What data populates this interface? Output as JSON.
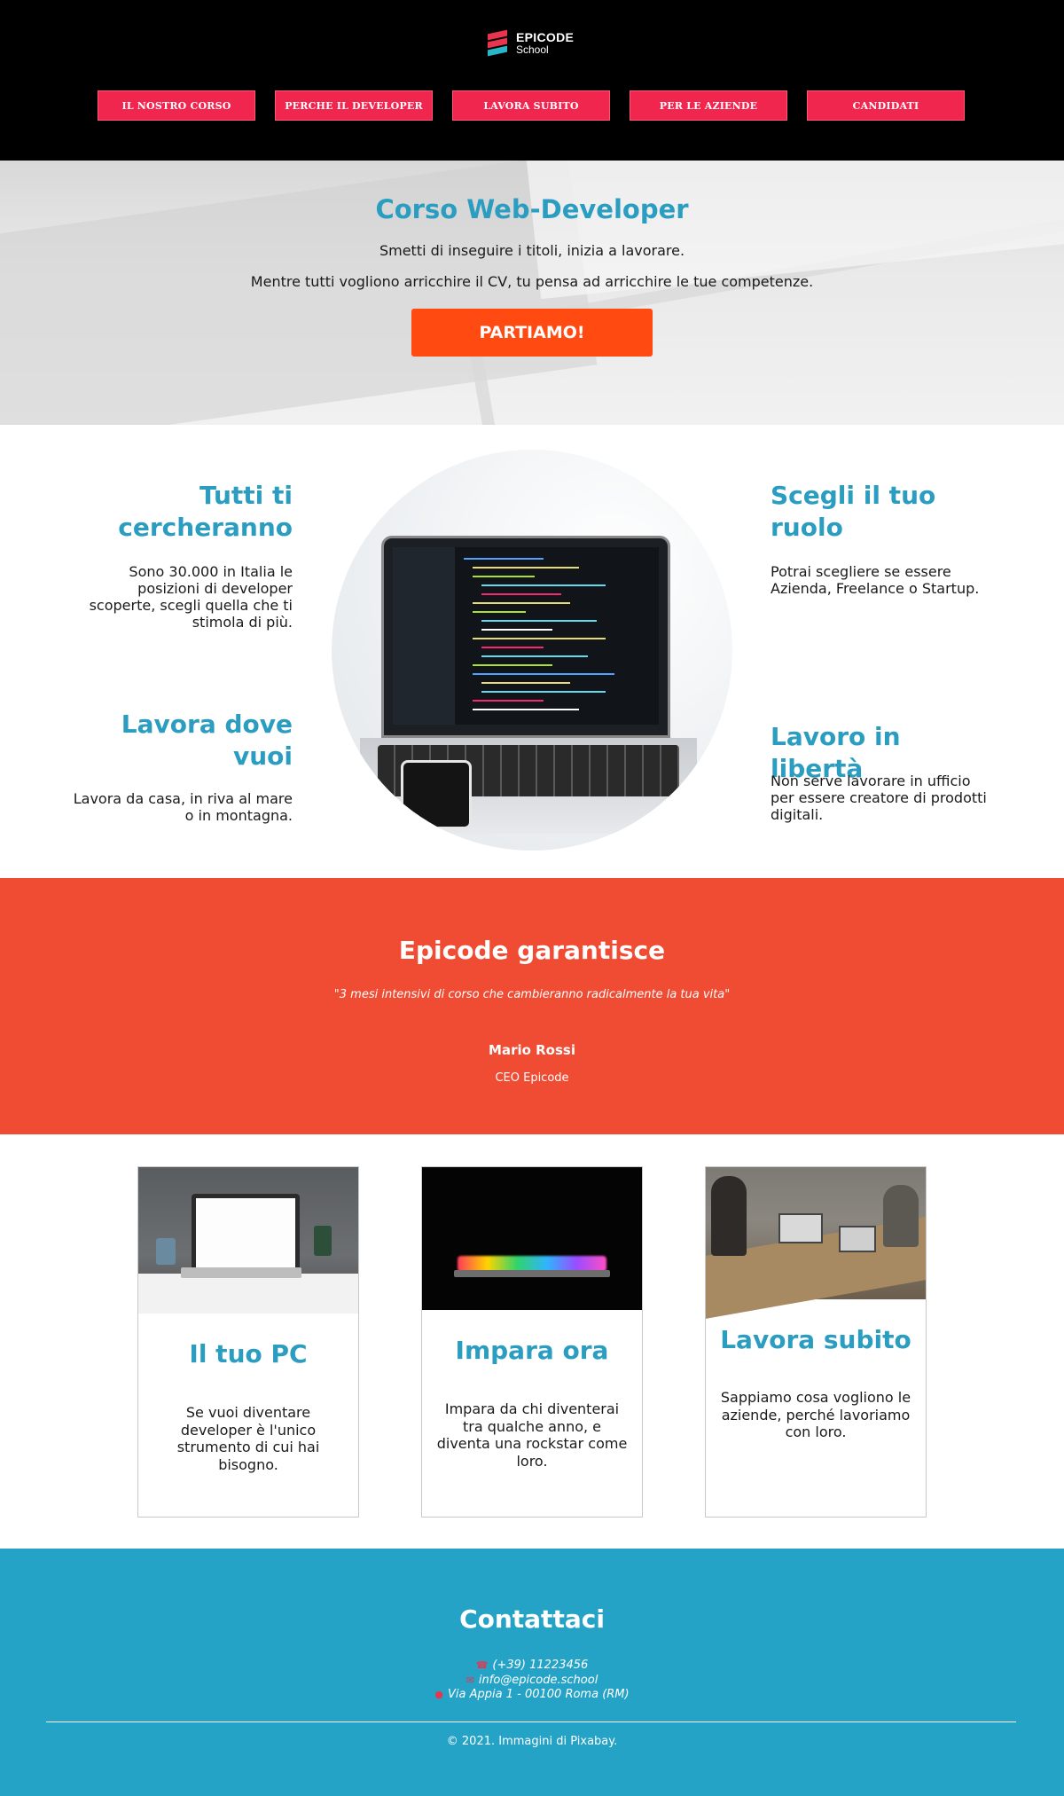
{
  "header": {
    "logo": {
      "title": "EPICODE",
      "subtitle": "School"
    },
    "nav": [
      {
        "label": "IL NOSTRO CORSO"
      },
      {
        "label": "PERCHE IL DEVELOPER"
      },
      {
        "label": "LAVORA SUBITO"
      },
      {
        "label": "PER LE AZIENDE"
      },
      {
        "label": "CANDIDATI"
      }
    ]
  },
  "hero": {
    "title": "Corso Web-Developer",
    "line1": "Smetti di inseguire i titoli, inizia a lavorare.",
    "line2": "Mentre tutti vogliono arricchire il CV, tu pensa ad arricchire le tue competenze.",
    "cta": "PARTIAMO!"
  },
  "features": [
    {
      "title": "Tutti ti cercheranno",
      "text": "Sono 30.000 in Italia le posizioni di developer scoperte, scegli quella che ti stimola di più."
    },
    {
      "title": "Scegli il tuo ruolo",
      "text": "Potrai scegliere se essere Azienda, Freelance o Startup."
    },
    {
      "title": "Lavora dove vuoi",
      "text": "Lavora da casa, in riva al mare o in montagna."
    },
    {
      "title": "Lavoro in libertà",
      "text": "Non serve lavorare in ufficio per essere creatore di prodotti digitali."
    }
  ],
  "guarantee": {
    "title": "Epicode garantisce",
    "quote": "\"3 mesi intensivi di corso che cambieranno radicalmente la tua vita\"",
    "name": "Mario Rossi",
    "role": "CEO Epicode"
  },
  "cards": [
    {
      "title": "Il tuo PC",
      "text": "Se vuoi diventare developer è l'unico strumento di cui hai bisogno."
    },
    {
      "title": "Impara ora",
      "text": "Impara da chi diventerai tra qualche anno, e diventa una rockstar come loro."
    },
    {
      "title": "Lavora subito",
      "text": "Sappiamo cosa vogliono le aziende, perché lavoriamo con loro."
    }
  ],
  "contact": {
    "title": "Contattaci",
    "phone": "(+39) 11223456",
    "email": "info@epicode.school",
    "address": "Via Appia 1 - 00100 Roma (RM)",
    "copyright": "© 2021. Immagini di Pixabay."
  },
  "colors": {
    "accent_blue": "#2a9dc0",
    "nav_pink": "#f0264e",
    "cta_orange": "#ff4b12",
    "guarantee_red": "#ef4c33",
    "contact_blue": "#24a3c7"
  },
  "icons": {
    "phone": "phone-icon",
    "email": "envelope-icon",
    "address": "map-marker-icon"
  }
}
